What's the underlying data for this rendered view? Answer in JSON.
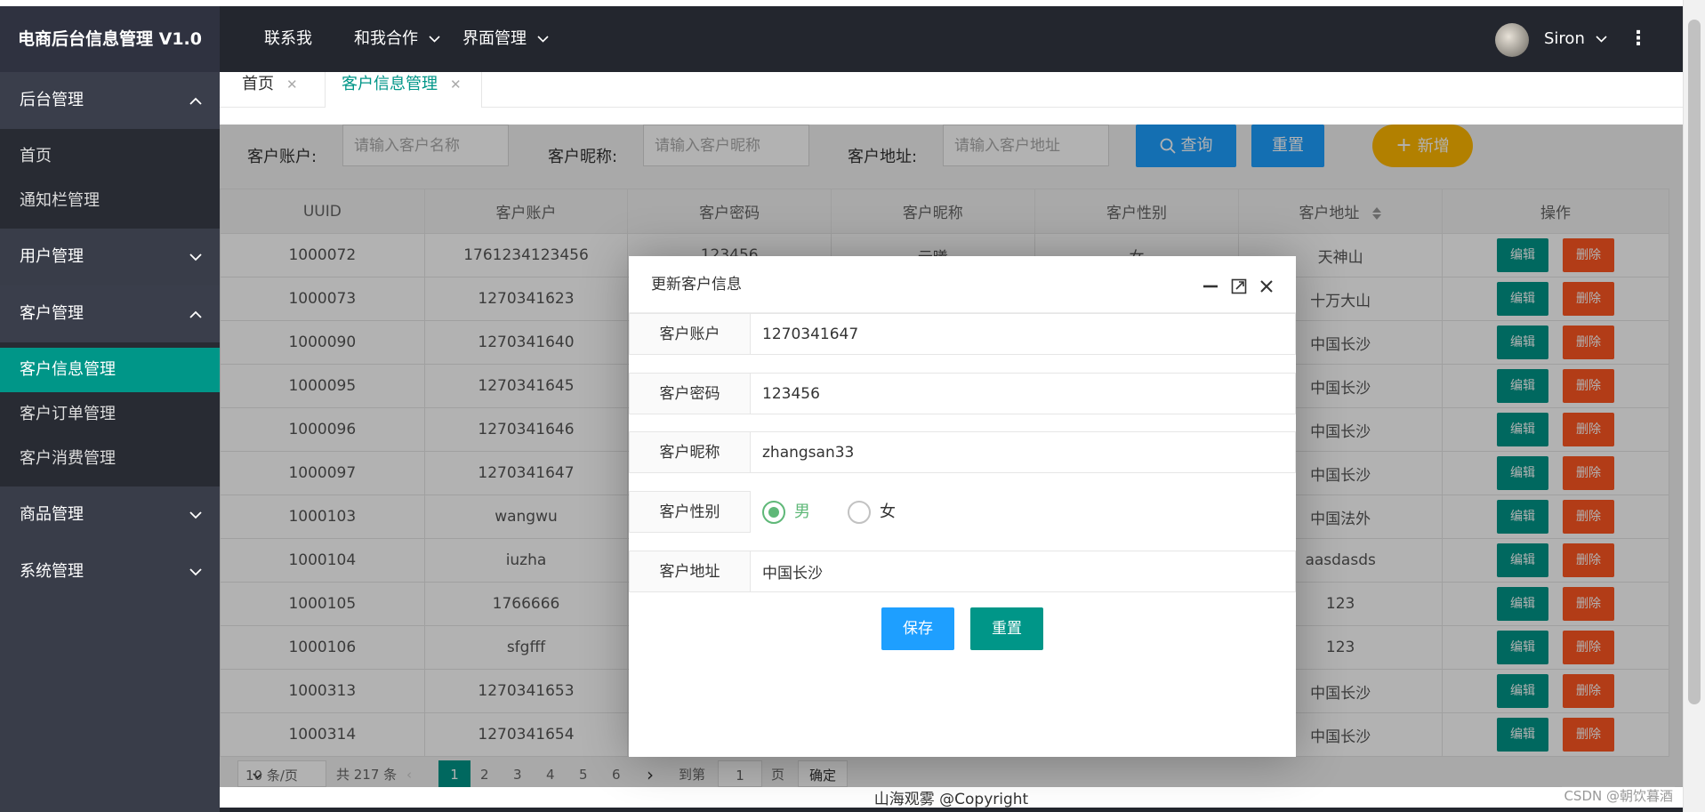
{
  "app": {
    "title": "电商后台信息管理 V1.0"
  },
  "sidebar": {
    "groups": [
      {
        "label": "后台管理",
        "items": [
          "首页",
          "通知栏管理"
        ]
      },
      {
        "label": "用户管理"
      },
      {
        "label": "客户管理",
        "items": [
          "客户信息管理",
          "客户订单管理",
          "客户消费管理"
        ]
      },
      {
        "label": "商品管理"
      },
      {
        "label": "系统管理"
      }
    ]
  },
  "header": {
    "nav": [
      "联系我",
      "和我合作",
      "界面管理"
    ],
    "user": "Siron"
  },
  "tabs": [
    "首页",
    "客户信息管理"
  ],
  "search": {
    "account_label": "客户账户:",
    "account_placeholder": "请输入客户名称",
    "nickname_label": "客户昵称:",
    "nickname_placeholder": "请输入客户昵称",
    "address_label": "客户地址:",
    "address_placeholder": "请输入客户地址",
    "query": "查询",
    "reset": "重置",
    "add": "新增"
  },
  "table": {
    "columns": [
      "UUID",
      "客户账户",
      "客户密码",
      "客户昵称",
      "客户性别",
      "客户地址",
      "操作"
    ],
    "edit": "编辑",
    "delete": "删除",
    "rows": [
      {
        "uuid": "1000072",
        "account": "1761234123456",
        "password": "123456",
        "nickname": "云曦",
        "gender": "女",
        "address": "天神山"
      },
      {
        "uuid": "1000073",
        "account": "1270341623",
        "password": "",
        "nickname": "",
        "gender": "",
        "address": "十万大山"
      },
      {
        "uuid": "1000090",
        "account": "1270341640",
        "password": "",
        "nickname": "",
        "gender": "",
        "address": "中国长沙"
      },
      {
        "uuid": "1000095",
        "account": "1270341645",
        "password": "",
        "nickname": "",
        "gender": "",
        "address": "中国长沙"
      },
      {
        "uuid": "1000096",
        "account": "1270341646",
        "password": "",
        "nickname": "",
        "gender": "",
        "address": "中国长沙"
      },
      {
        "uuid": "1000097",
        "account": "1270341647",
        "password": "",
        "nickname": "",
        "gender": "",
        "address": "中国长沙"
      },
      {
        "uuid": "1000103",
        "account": "wangwu",
        "password": "",
        "nickname": "",
        "gender": "",
        "address": "中国法外"
      },
      {
        "uuid": "1000104",
        "account": "iuzha",
        "password": "",
        "nickname": "",
        "gender": "",
        "address": "aasdasds"
      },
      {
        "uuid": "1000105",
        "account": "1766666",
        "password": "",
        "nickname": "",
        "gender": "",
        "address": "123"
      },
      {
        "uuid": "1000106",
        "account": "sfgfff",
        "password": "",
        "nickname": "",
        "gender": "",
        "address": "123"
      },
      {
        "uuid": "1000313",
        "account": "1270341653",
        "password": "",
        "nickname": "",
        "gender": "",
        "address": "中国长沙"
      },
      {
        "uuid": "1000314",
        "account": "1270341654",
        "password": "",
        "nickname": "",
        "gender": "",
        "address": "中国长沙"
      }
    ]
  },
  "pager": {
    "limit": "10 条/页",
    "total": "共 217 条",
    "pages": [
      "1",
      "2",
      "3",
      "4",
      "5",
      "6"
    ],
    "current": "1",
    "goto": "到第",
    "goto_value": "1",
    "page_unit": "页",
    "confirm": "确定"
  },
  "footer": "山海观雾 @Copyright",
  "watermark": "CSDN @朝饮暮酒",
  "modal": {
    "title": "更新客户信息",
    "fields": [
      {
        "label": "客户账户",
        "value": "1270341647"
      },
      {
        "label": "客户密码",
        "value": "123456"
      },
      {
        "label": "客户昵称",
        "value": "zhangsan33"
      },
      {
        "label": "客户性别",
        "options": [
          "男",
          "女"
        ],
        "selected": "男"
      },
      {
        "label": "客户地址",
        "value": "中国长沙"
      }
    ],
    "save": "保存",
    "reset": "重置"
  },
  "colors": {
    "accent": "#009688",
    "blue": "#1e9fff",
    "yellow": "#ffb800",
    "danger": "#ff5722",
    "header_bg": "#23262e",
    "sidebar_bg": "#393d49"
  }
}
